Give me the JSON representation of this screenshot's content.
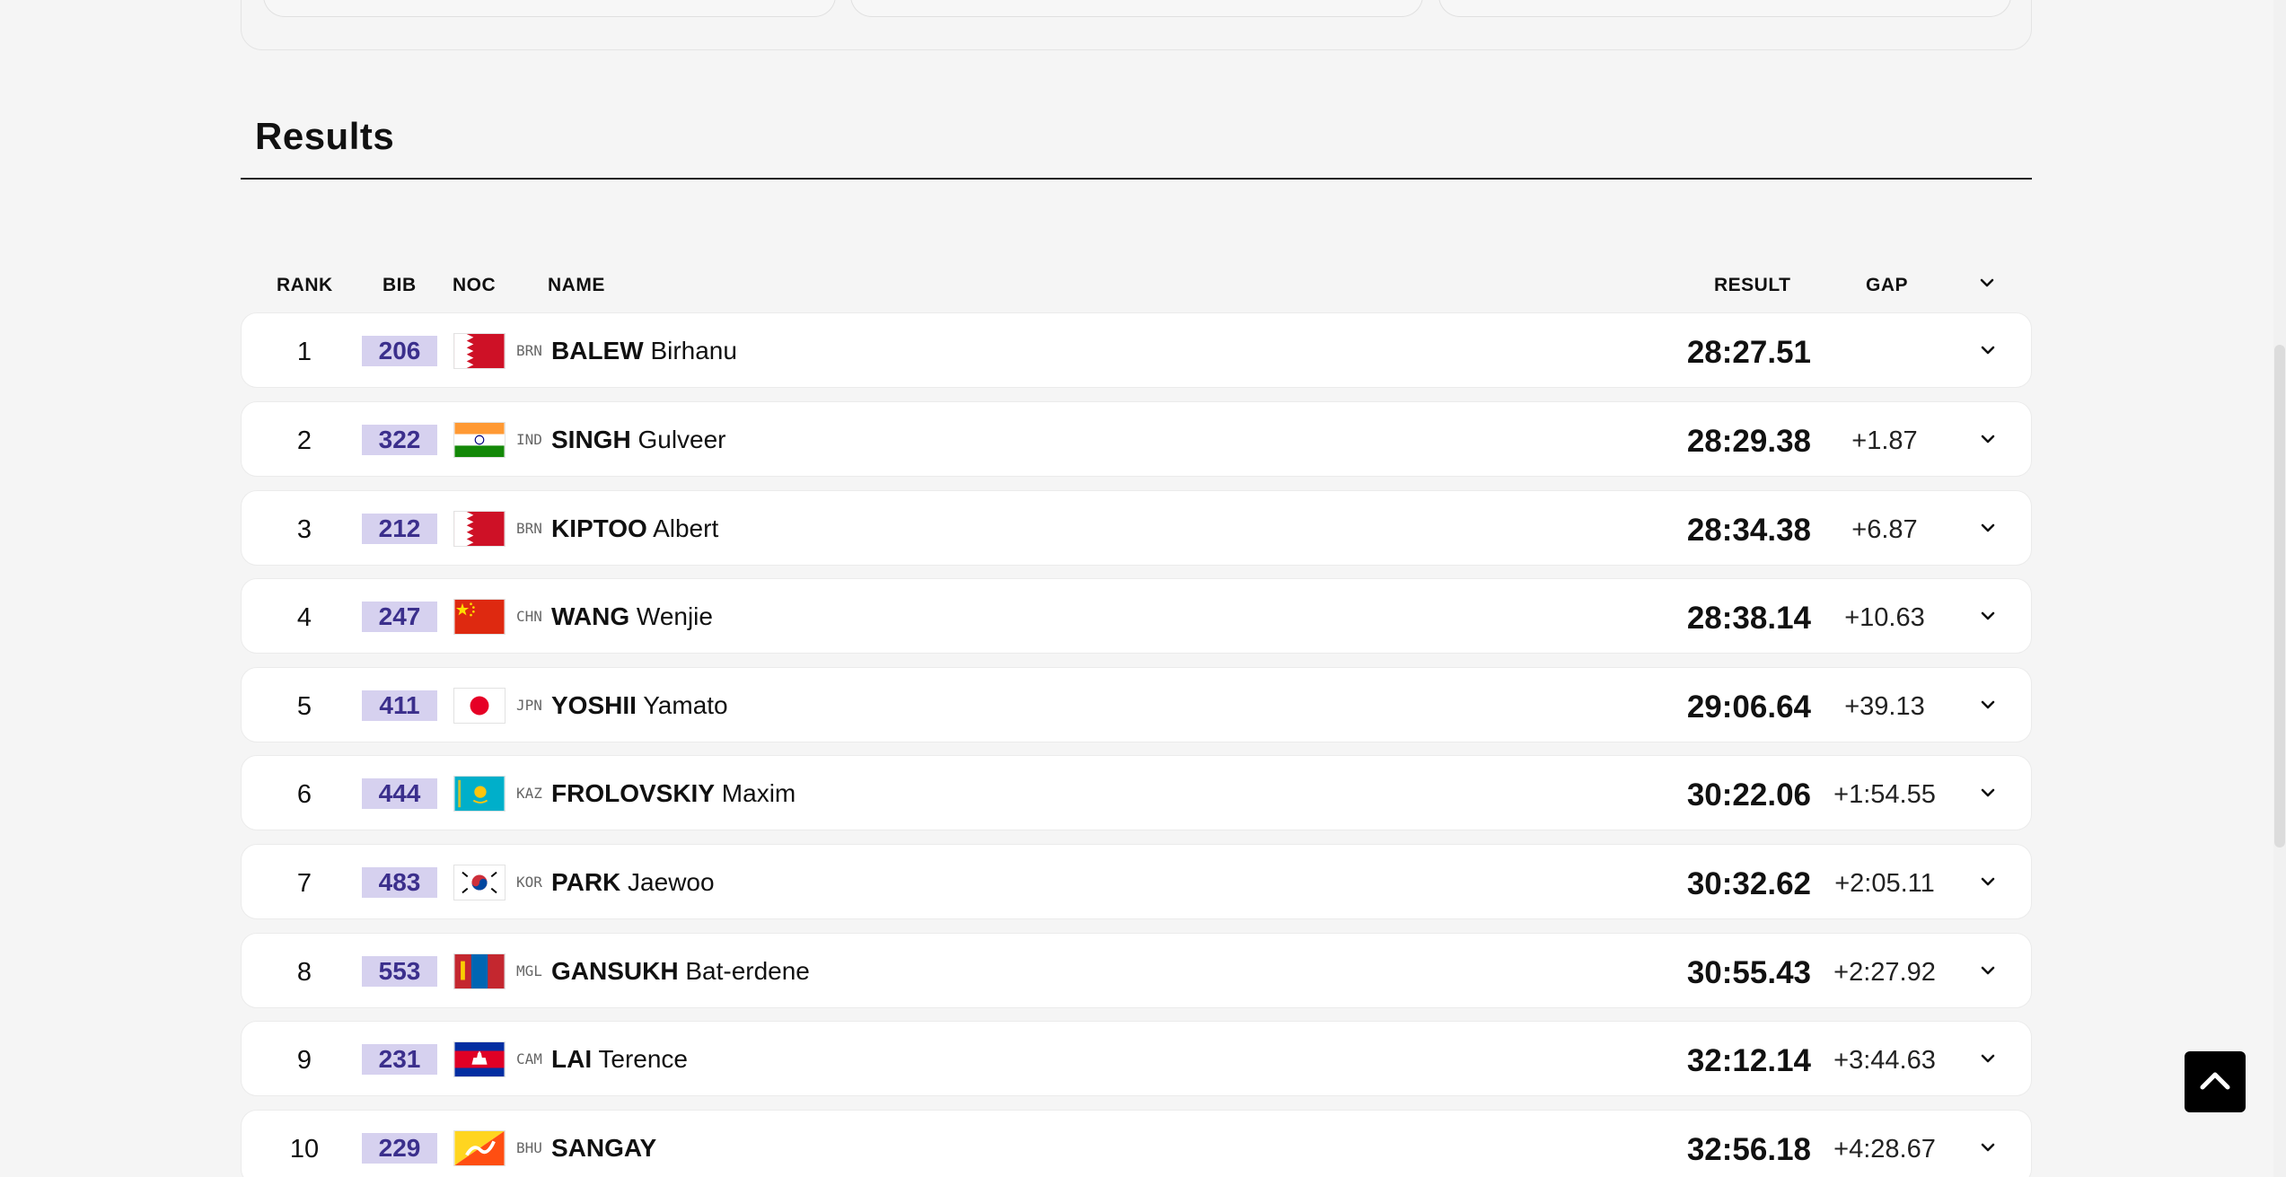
{
  "section_title": "Results",
  "columns": {
    "rank": "RANK",
    "bib": "BIB",
    "noc": "NOC",
    "name": "NAME",
    "result": "RESULT",
    "gap": "GAP"
  },
  "rows": [
    {
      "rank": "1",
      "bib": "206",
      "noc": "BRN",
      "surname": "BALEW",
      "given": "Birhanu",
      "result": "28:27.51",
      "gap": ""
    },
    {
      "rank": "2",
      "bib": "322",
      "noc": "IND",
      "surname": "SINGH",
      "given": "Gulveer",
      "result": "28:29.38",
      "gap": "+1.87"
    },
    {
      "rank": "3",
      "bib": "212",
      "noc": "BRN",
      "surname": "KIPTOO",
      "given": "Albert",
      "result": "28:34.38",
      "gap": "+6.87"
    },
    {
      "rank": "4",
      "bib": "247",
      "noc": "CHN",
      "surname": "WANG",
      "given": "Wenjie",
      "result": "28:38.14",
      "gap": "+10.63"
    },
    {
      "rank": "5",
      "bib": "411",
      "noc": "JPN",
      "surname": "YOSHII",
      "given": "Yamato",
      "result": "29:06.64",
      "gap": "+39.13"
    },
    {
      "rank": "6",
      "bib": "444",
      "noc": "KAZ",
      "surname": "FROLOVSKIY",
      "given": "Maxim",
      "result": "30:22.06",
      "gap": "+1:54.55"
    },
    {
      "rank": "7",
      "bib": "483",
      "noc": "KOR",
      "surname": "PARK",
      "given": "Jaewoo",
      "result": "30:32.62",
      "gap": "+2:05.11"
    },
    {
      "rank": "8",
      "bib": "553",
      "noc": "MGL",
      "surname": "GANSUKH",
      "given": "Bat-erdene",
      "result": "30:55.43",
      "gap": "+2:27.92"
    },
    {
      "rank": "9",
      "bib": "231",
      "noc": "CAM",
      "surname": "LAI",
      "given": "Terence",
      "result": "32:12.14",
      "gap": "+3:44.63"
    },
    {
      "rank": "10",
      "bib": "229",
      "noc": "BHU",
      "surname": "SANGAY",
      "given": "",
      "result": "32:56.18",
      "gap": "+4:28.67"
    }
  ],
  "icons": {
    "expand": "chevron-down-icon",
    "scroll_top": "chevron-up-icon"
  },
  "colors": {
    "bib_bg": "#d6d1ef",
    "bib_text": "#3b2f8c",
    "page_bg": "#f5f5f5"
  }
}
